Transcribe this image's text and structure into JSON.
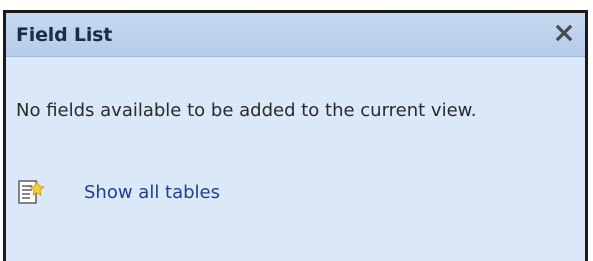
{
  "pane": {
    "title": "Field List",
    "close_icon": "close-icon",
    "message": "No fields available to be added to the current view.",
    "show_all_tables_label": "Show all tables",
    "show_all_tables_icon": "table-add-icon"
  },
  "colors": {
    "pane_background": "#dbe8f8",
    "header_background": "#c6d9f1",
    "title_text": "#1f2a44",
    "link_text": "#1f3f8f",
    "border": "#1a1a1a"
  }
}
